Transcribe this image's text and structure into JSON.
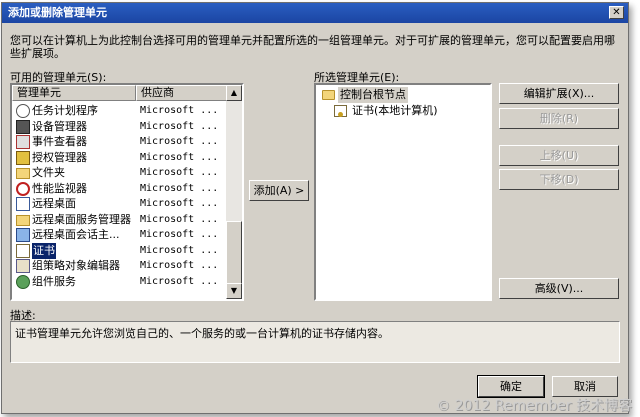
{
  "dialog": {
    "title": "添加或删除管理单元",
    "close_glyph": "✕",
    "description": "您可以在计算机上为此控制台选择可用的管理单元并配置所选的一组管理单元。对于可扩展的管理单元，您可以配置要启用哪些扩展项。"
  },
  "available": {
    "label": "可用的管理单元(S):",
    "col_name": "管理单元",
    "col_vendor": "供应商",
    "items": [
      {
        "name": "任务计划程序",
        "vendor": "Microsoft ...",
        "icon": "clock-icon"
      },
      {
        "name": "设备管理器",
        "vendor": "Microsoft ...",
        "icon": "device-manager-icon"
      },
      {
        "name": "事件查看器",
        "vendor": "Microsoft ...",
        "icon": "event-viewer-icon"
      },
      {
        "name": "授权管理器",
        "vendor": "Microsoft ...",
        "icon": "authorization-icon"
      },
      {
        "name": "文件夹",
        "vendor": "Microsoft ...",
        "icon": "folder-icon"
      },
      {
        "name": "性能监视器",
        "vendor": "Microsoft ...",
        "icon": "performance-icon"
      },
      {
        "name": "远程桌面",
        "vendor": "Microsoft ...",
        "icon": "remote-desktop-icon"
      },
      {
        "name": "远程桌面服务管理器",
        "vendor": "Microsoft ...",
        "icon": "folder-icon"
      },
      {
        "name": "远程桌面会话主...",
        "vendor": "Microsoft ...",
        "icon": "remote-session-icon"
      },
      {
        "name": "证书",
        "vendor": "Microsoft ...",
        "icon": "certificate-icon",
        "selected": true
      },
      {
        "name": "组策略对象编辑器",
        "vendor": "Microsoft ...",
        "icon": "group-policy-icon"
      },
      {
        "name": "组件服务",
        "vendor": "Microsoft ...",
        "icon": "component-services-icon"
      }
    ]
  },
  "add_button": "添加(A) >",
  "selected": {
    "label": "所选管理单元(E):",
    "root": "控制台根节点",
    "child": "证书(本地计算机)"
  },
  "buttons": {
    "edit_extensions": "编辑扩展(X)...",
    "remove": "删除(R)",
    "move_up": "上移(U)",
    "move_down": "下移(D)",
    "advanced": "高级(V)..."
  },
  "info": {
    "label": "描述:",
    "text": "证书管理单元允许您浏览自己的、一个服务的或一台计算机的证书存储内容。"
  },
  "footer": {
    "ok": "确定",
    "cancel": "取消"
  },
  "watermark": "© 2012 Remember 技术博客"
}
